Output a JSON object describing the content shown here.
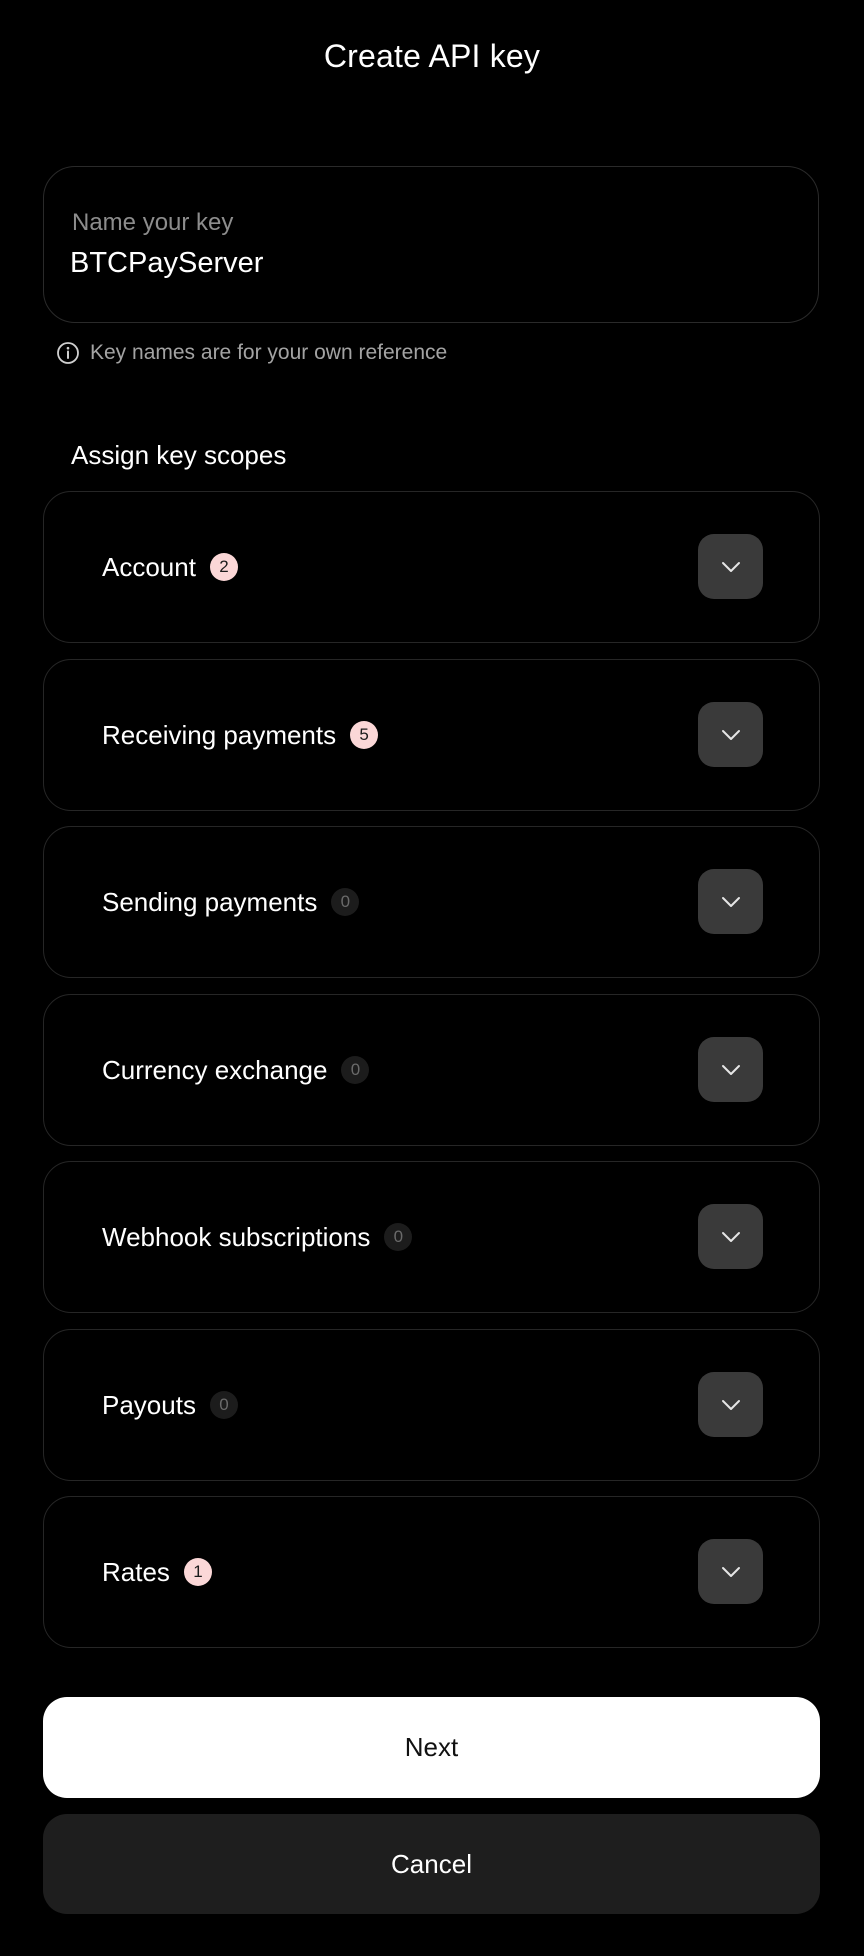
{
  "header": {
    "title": "Create API key"
  },
  "key_name": {
    "label": "Name your key",
    "value": "BTCPayServer",
    "hint": "Key names are for your own reference"
  },
  "scopes": {
    "heading": "Assign key scopes",
    "items": [
      {
        "label": "Account",
        "count": "2"
      },
      {
        "label": "Receiving payments",
        "count": "5"
      },
      {
        "label": "Sending payments",
        "count": "0"
      },
      {
        "label": "Currency exchange",
        "count": "0"
      },
      {
        "label": "Webhook subscriptions",
        "count": "0"
      },
      {
        "label": "Payouts",
        "count": "0"
      },
      {
        "label": "Rates",
        "count": "1"
      }
    ]
  },
  "actions": {
    "next_label": "Next",
    "cancel_label": "Cancel"
  },
  "colors": {
    "background": "#000000",
    "badge_active": "#fbd7d7",
    "badge_zero": "#1c1c1c",
    "expand_button": "#3a3a3a",
    "primary_button": "#ffffff",
    "secondary_button": "#1e1e1e"
  },
  "icons": {
    "info": "info-icon",
    "expand": "chevron-down-icon"
  }
}
